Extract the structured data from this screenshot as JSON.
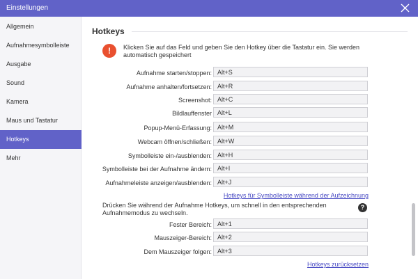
{
  "window": {
    "title": "Einstellungen"
  },
  "sidebar": {
    "items": [
      {
        "label": "Allgemein"
      },
      {
        "label": "Aufnahmesymbolleiste"
      },
      {
        "label": "Ausgabe"
      },
      {
        "label": "Sound"
      },
      {
        "label": "Kamera"
      },
      {
        "label": "Maus und Tastatur"
      },
      {
        "label": "Hotkeys"
      },
      {
        "label": "Mehr"
      }
    ],
    "active": "Hotkeys"
  },
  "main": {
    "section_title": "Hotkeys",
    "notice": "Klicken Sie auf das Feld und geben Sie den Hotkey über die Tastatur ein. Sie werden automatisch gespeichert",
    "hotkeys": [
      {
        "label": "Aufnahme starten/stoppen:",
        "value": "Alt+S"
      },
      {
        "label": "Aufnahme anhalten/fortsetzen:",
        "value": "Alt+R"
      },
      {
        "label": "Screenshot:",
        "value": "Alt+C"
      },
      {
        "label": "Bildlauffenster",
        "value": "Alt+L"
      },
      {
        "label": "Popup-Menü-Erfassung:",
        "value": "Alt+M"
      },
      {
        "label": "Webcam öffnen/schließen:",
        "value": "Alt+W"
      },
      {
        "label": "Symbolleiste ein-/ausblenden:",
        "value": "Alt+H"
      },
      {
        "label": "Symbolleiste bei der Aufnahme ändern:",
        "value": "Alt+I"
      },
      {
        "label": "Aufnahmeleiste anzeigen/ausblenden:",
        "value": "Alt+J"
      }
    ],
    "toolbar_hotkeys_link": "Hotkeys für Symbolleiste während der Aufzeichnung",
    "mode_text": "Drücken Sie während der Aufnahme Hotkeys, um schnell in den entsprechenden Aufnahmemodus zu wechseln.",
    "mode_hotkeys": [
      {
        "label": "Fester Bereich:",
        "value": "Alt+1"
      },
      {
        "label": "Mauszeiger-Bereich:",
        "value": "Alt+2"
      },
      {
        "label": "Dem Mauszeiger folgen:",
        "value": "Alt+3"
      }
    ],
    "reset_link": "Hotkeys zurücksetzen"
  },
  "colors": {
    "accent": "#6162c8",
    "warning": "#e9502f",
    "link": "#4a4cc4"
  },
  "icons": {
    "close": "close-icon",
    "warning": "exclamation-icon",
    "help": "question-icon"
  }
}
